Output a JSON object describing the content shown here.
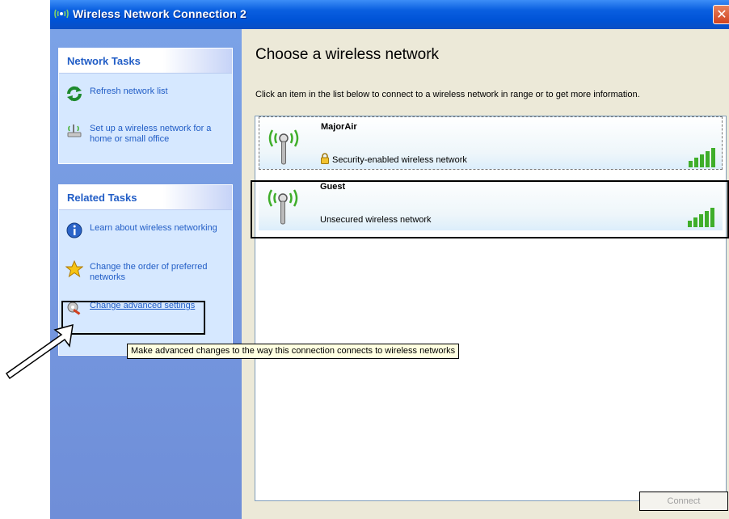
{
  "window": {
    "title": "Wireless Network Connection 2",
    "close_label": "✕",
    "title_icon": "wireless-network-icon"
  },
  "sidebar": {
    "network_tasks": {
      "header": "Network Tasks",
      "items": [
        {
          "label": "Refresh network list",
          "icon": "refresh-icon"
        },
        {
          "label": "Set up a wireless network for a home or small office",
          "icon": "wireless-setup-icon"
        }
      ]
    },
    "related_tasks": {
      "header": "Related Tasks",
      "items": [
        {
          "label": "Learn about wireless networking",
          "icon": "info-icon"
        },
        {
          "label": "Change the order of preferred networks",
          "icon": "star-icon"
        },
        {
          "label": "Change advanced settings",
          "icon": "advanced-settings-icon"
        }
      ]
    }
  },
  "main": {
    "heading": "Choose a wireless network",
    "instruction": "Click an item in the list below to connect to a wireless network in range or to get more information.",
    "networks": [
      {
        "name": "MajorAir",
        "status": "Security-enabled wireless network",
        "secured": true,
        "signal_bars": 5
      },
      {
        "name": "Guest",
        "status": "Unsecured wireless network",
        "secured": false,
        "signal_bars": 5
      }
    ],
    "connect_label": "Connect"
  },
  "tooltip": {
    "text": "Make advanced changes to the way this connection connects to wireless networks"
  },
  "colors": {
    "titlebar": "#0053d6",
    "sidebar_bg": "#7ba2e7",
    "panel_bg": "#d6e8ff",
    "link": "#215dc6",
    "content_bg": "#ece9d8",
    "signal_green": "#3fae2a"
  }
}
